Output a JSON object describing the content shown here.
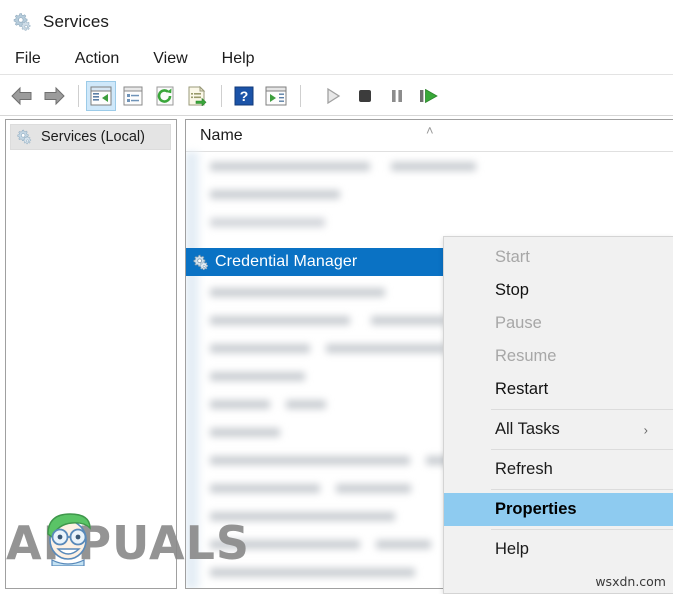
{
  "window": {
    "title": "Services",
    "icon": "services-gear-icon"
  },
  "menubar": {
    "items": [
      {
        "label": "File"
      },
      {
        "label": "Action"
      },
      {
        "label": "View"
      },
      {
        "label": "Help"
      }
    ]
  },
  "toolbar": {
    "buttons": [
      {
        "name": "back-arrow-icon",
        "tooltip": "Back"
      },
      {
        "name": "forward-arrow-icon",
        "tooltip": "Forward"
      },
      {
        "name": "show-hide-console-tree-icon",
        "tooltip": "Show/Hide Console Tree",
        "active": true
      },
      {
        "name": "properties-icon",
        "tooltip": "Properties"
      },
      {
        "name": "refresh-icon",
        "tooltip": "Refresh"
      },
      {
        "name": "export-list-icon",
        "tooltip": "Export List"
      },
      {
        "name": "help-icon",
        "tooltip": "Help"
      },
      {
        "name": "show-hide-action-pane-icon",
        "tooltip": "Show/Hide Action Pane"
      },
      {
        "name": "start-service-icon",
        "tooltip": "Start Service"
      },
      {
        "name": "stop-service-icon",
        "tooltip": "Stop Service"
      },
      {
        "name": "pause-service-icon",
        "tooltip": "Pause Service"
      },
      {
        "name": "restart-service-icon",
        "tooltip": "Restart Service"
      }
    ]
  },
  "tree": {
    "root_label": "Services (Local)",
    "root_icon": "services-gear-icon"
  },
  "list": {
    "column_header": "Name",
    "sort_indicator": "˄",
    "selected_row": {
      "label": "Credential Manager",
      "icon": "service-gear-icon"
    }
  },
  "context_menu": {
    "items": [
      {
        "label": "Start",
        "state": "disabled"
      },
      {
        "label": "Stop",
        "state": "enabled"
      },
      {
        "label": "Pause",
        "state": "disabled"
      },
      {
        "label": "Resume",
        "state": "disabled"
      },
      {
        "label": "Restart",
        "state": "enabled"
      },
      {
        "label": "All Tasks",
        "state": "enabled",
        "submenu": "›"
      },
      {
        "label": "Refresh",
        "state": "enabled"
      },
      {
        "label": "Properties",
        "state": "selected"
      },
      {
        "label": "Help",
        "state": "enabled"
      }
    ]
  },
  "watermarks": {
    "appuals": "APPUALS",
    "wsxdn": "wsxdn.com"
  },
  "colors": {
    "selection_blue": "#0a72c4",
    "menu_highlight": "#8ecbf0",
    "toolbar_active": "#cfe8fa"
  }
}
